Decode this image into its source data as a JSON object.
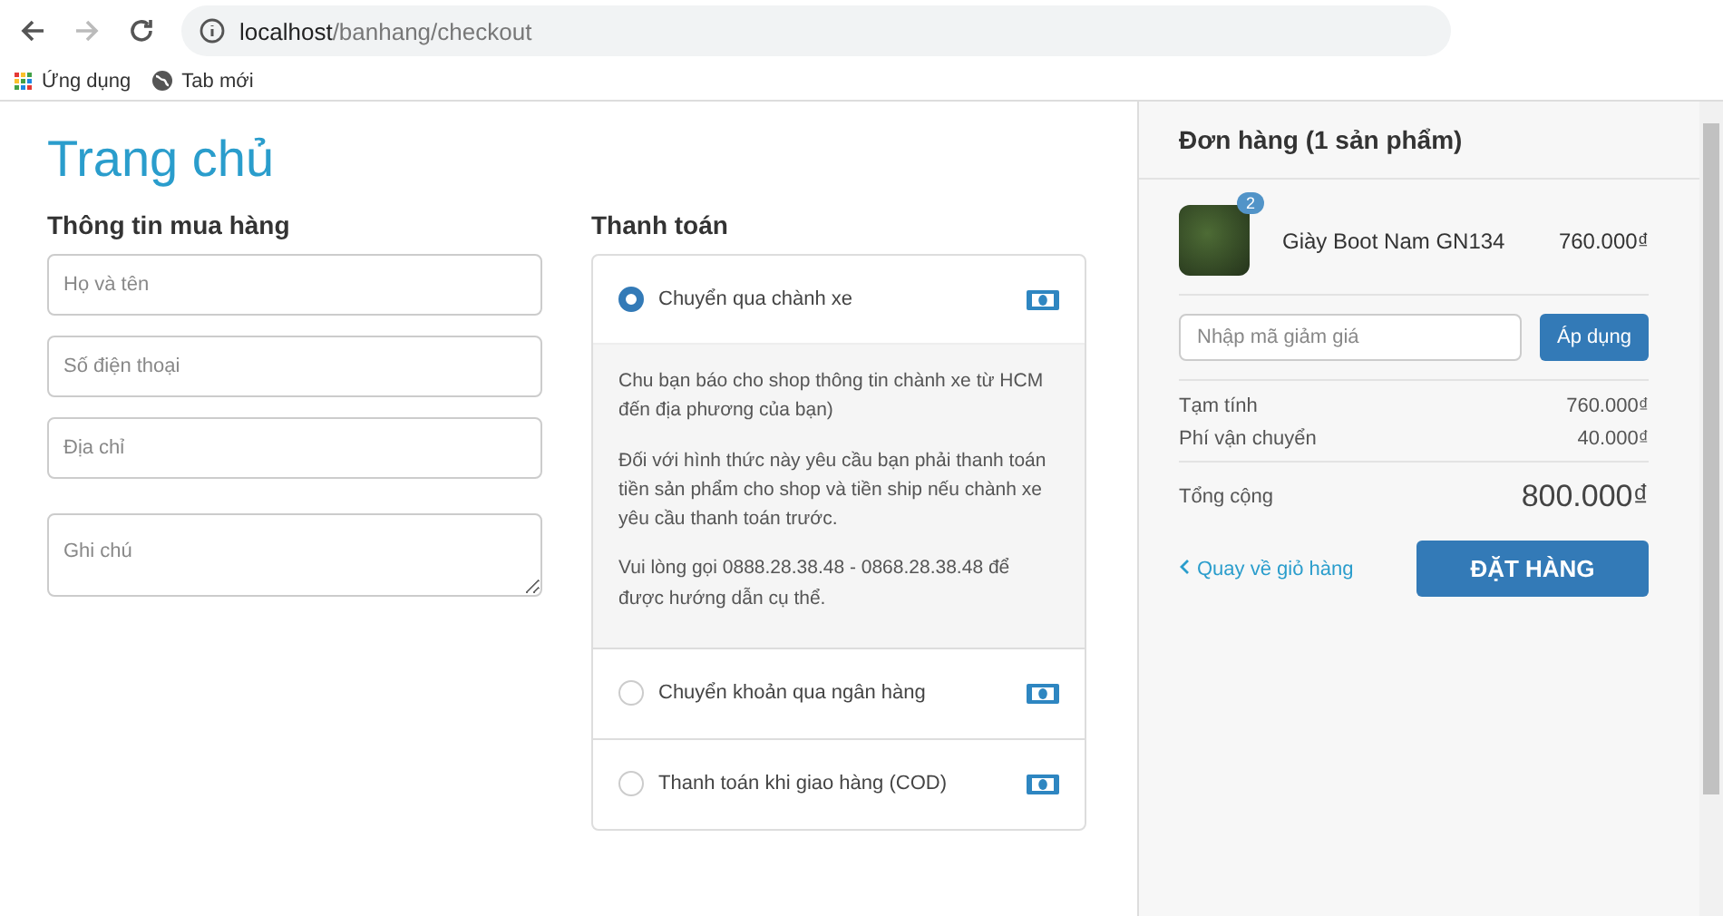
{
  "browser": {
    "url_host": "localhost",
    "url_path": "/banhang/checkout",
    "bookmarks": [
      {
        "label": "Ứng dụng",
        "kind": "apps"
      },
      {
        "label": "Tab mới",
        "kind": "globe"
      }
    ]
  },
  "page": {
    "title": "Trang chủ"
  },
  "buyer": {
    "heading": "Thông tin mua hàng",
    "fields": [
      {
        "placeholder": "Họ và tên",
        "kind": "input"
      },
      {
        "placeholder": "Số điện thoại",
        "kind": "input"
      },
      {
        "placeholder": "Địa chỉ",
        "kind": "input"
      },
      {
        "placeholder": "Ghi chú",
        "kind": "textarea"
      }
    ]
  },
  "payment": {
    "heading": "Thanh toán",
    "methods": [
      {
        "label": "Chuyển qua chành xe",
        "selected": true,
        "details": [
          "Chu bạn báo cho shop thông tin chành xe từ HCM đến địa phương của bạn)",
          "Đối với hình thức này yêu cầu bạn phải thanh toán tiền sản phẩm cho shop và tiền ship nếu chành xe yêu cầu thanh toán trước.",
          "Vui lòng gọi 0888.28.38.48 - 0868.28.38.48 để được hướng dẫn cụ thể."
        ]
      },
      {
        "label": "Chuyển khoản qua ngân hàng",
        "selected": false
      },
      {
        "label": "Thanh toán khi giao hàng (COD)",
        "selected": false
      }
    ]
  },
  "order": {
    "heading": "Đơn hàng (1 sản phẩm)",
    "items": [
      {
        "name": "Giày Boot Nam GN134",
        "quantity": "2",
        "price": "760.000₫"
      }
    ],
    "coupon": {
      "placeholder": "Nhập mã giảm giá",
      "button": "Áp dụng"
    },
    "lines": [
      {
        "label": "Tạm tính",
        "value": "760.000₫"
      },
      {
        "label": "Phí vận chuyển",
        "value": "40.000₫"
      }
    ],
    "total": {
      "label": "Tổng cộng",
      "value": "800.000₫"
    },
    "back_link": "Quay về giỏ hàng",
    "submit": "ĐẶT HÀNG"
  }
}
